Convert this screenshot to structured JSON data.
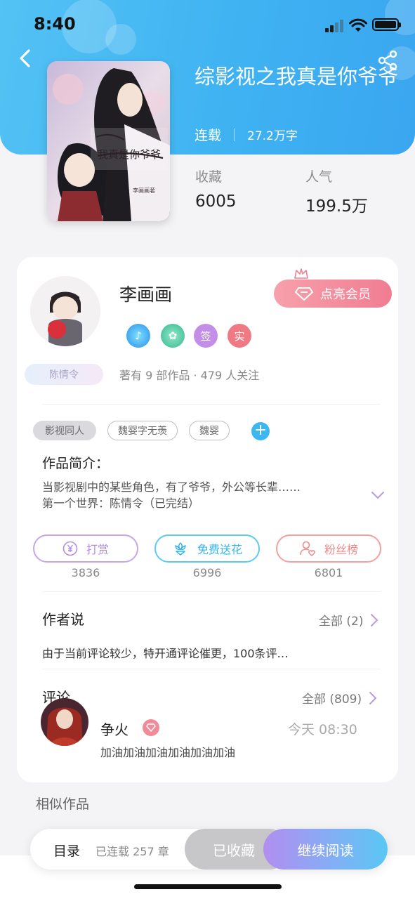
{
  "status_bar": {
    "time": "8:40"
  },
  "book": {
    "title": "综影视之我真是你爷爷",
    "status": "连载",
    "word_count": "27.2万字",
    "stats": [
      {
        "label": "收藏",
        "value": "6005"
      },
      {
        "label": "人气",
        "value": "199.5万"
      }
    ]
  },
  "author": {
    "name": "李画画",
    "badge_name": "陈情令",
    "vip_button": "点亮会员",
    "medals": [
      "签",
      "实"
    ],
    "works_summary": "著有 9 部作品 · 479 人关注"
  },
  "tags": {
    "items": [
      "影视同人",
      "魏婴字无羡",
      "魏婴"
    ],
    "add": "+"
  },
  "intro": {
    "heading": "作品简介：",
    "line1": "当影视剧中的某些角色，有了爷爷，外公等长辈……",
    "line2": "第一个世界：陈情令（已完结）"
  },
  "actions": [
    {
      "label": "打赏",
      "count": "3836",
      "icon": "yuan-icon",
      "color": "#b890e6"
    },
    {
      "label": "免费送花",
      "count": "6996",
      "icon": "flower-icon",
      "color": "#44c0ee"
    },
    {
      "label": "粉丝榜",
      "count": "6801",
      "icon": "fans-icon",
      "color": "#f08a8a"
    }
  ],
  "author_says": {
    "heading": "作者说",
    "more": "全部 (2)",
    "text": "由于当前评论较少，特开通评论催更，100条评…"
  },
  "comments": {
    "heading": "评论",
    "more": "全部 (809)",
    "item": {
      "user": "争火",
      "time": "今天 08:30",
      "text": "加油加油加油加油加油加油"
    }
  },
  "similar_heading": "相似作品",
  "bottom_bar": {
    "toc": "目录",
    "chapters": "已连载 257 章",
    "favorited": "已收藏",
    "continue": "继续阅读"
  },
  "colors": {
    "header_blue": "#3fb3f2",
    "vip_pink": "#f07d92",
    "accent_purple": "#b28ef0"
  }
}
